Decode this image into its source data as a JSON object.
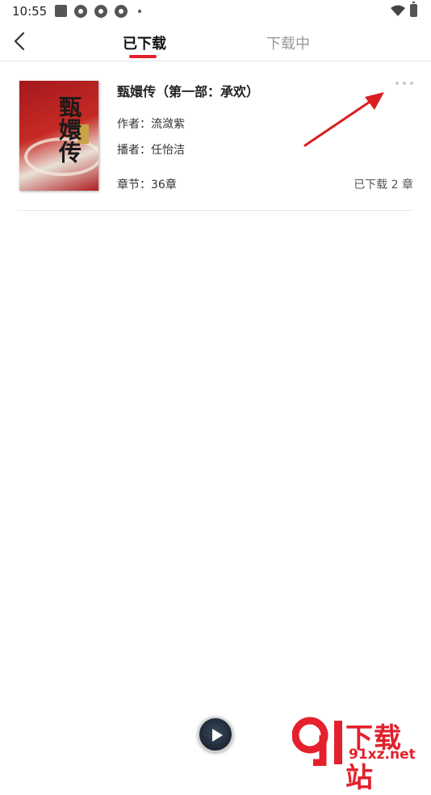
{
  "status_bar": {
    "time": "10:55",
    "icons": [
      "square-icon",
      "pinwheel-icon",
      "pinwheel-icon",
      "pinwheel-icon",
      "dot-icon",
      "wifi-icon",
      "battery-icon"
    ]
  },
  "header": {
    "back_icon": "chevron-left-icon",
    "tabs": [
      {
        "label": "已下载",
        "active": true
      },
      {
        "label": "下载中",
        "active": false
      }
    ],
    "accent_color": "#e4202c"
  },
  "book": {
    "cover_title": "甄嬛传",
    "title": "甄嬛传（第一部：承欢）",
    "author": "作者：流潋紫",
    "narrator": "播者：任怡洁",
    "chapters": "章节：36章",
    "downloaded": "已下载 2 章",
    "more_icon": "more-dots-icon"
  },
  "mini_player": {
    "icon": "play-icon"
  },
  "watermark": {
    "logo": "91-logo",
    "text": "下载站",
    "url": "91xz.net"
  }
}
